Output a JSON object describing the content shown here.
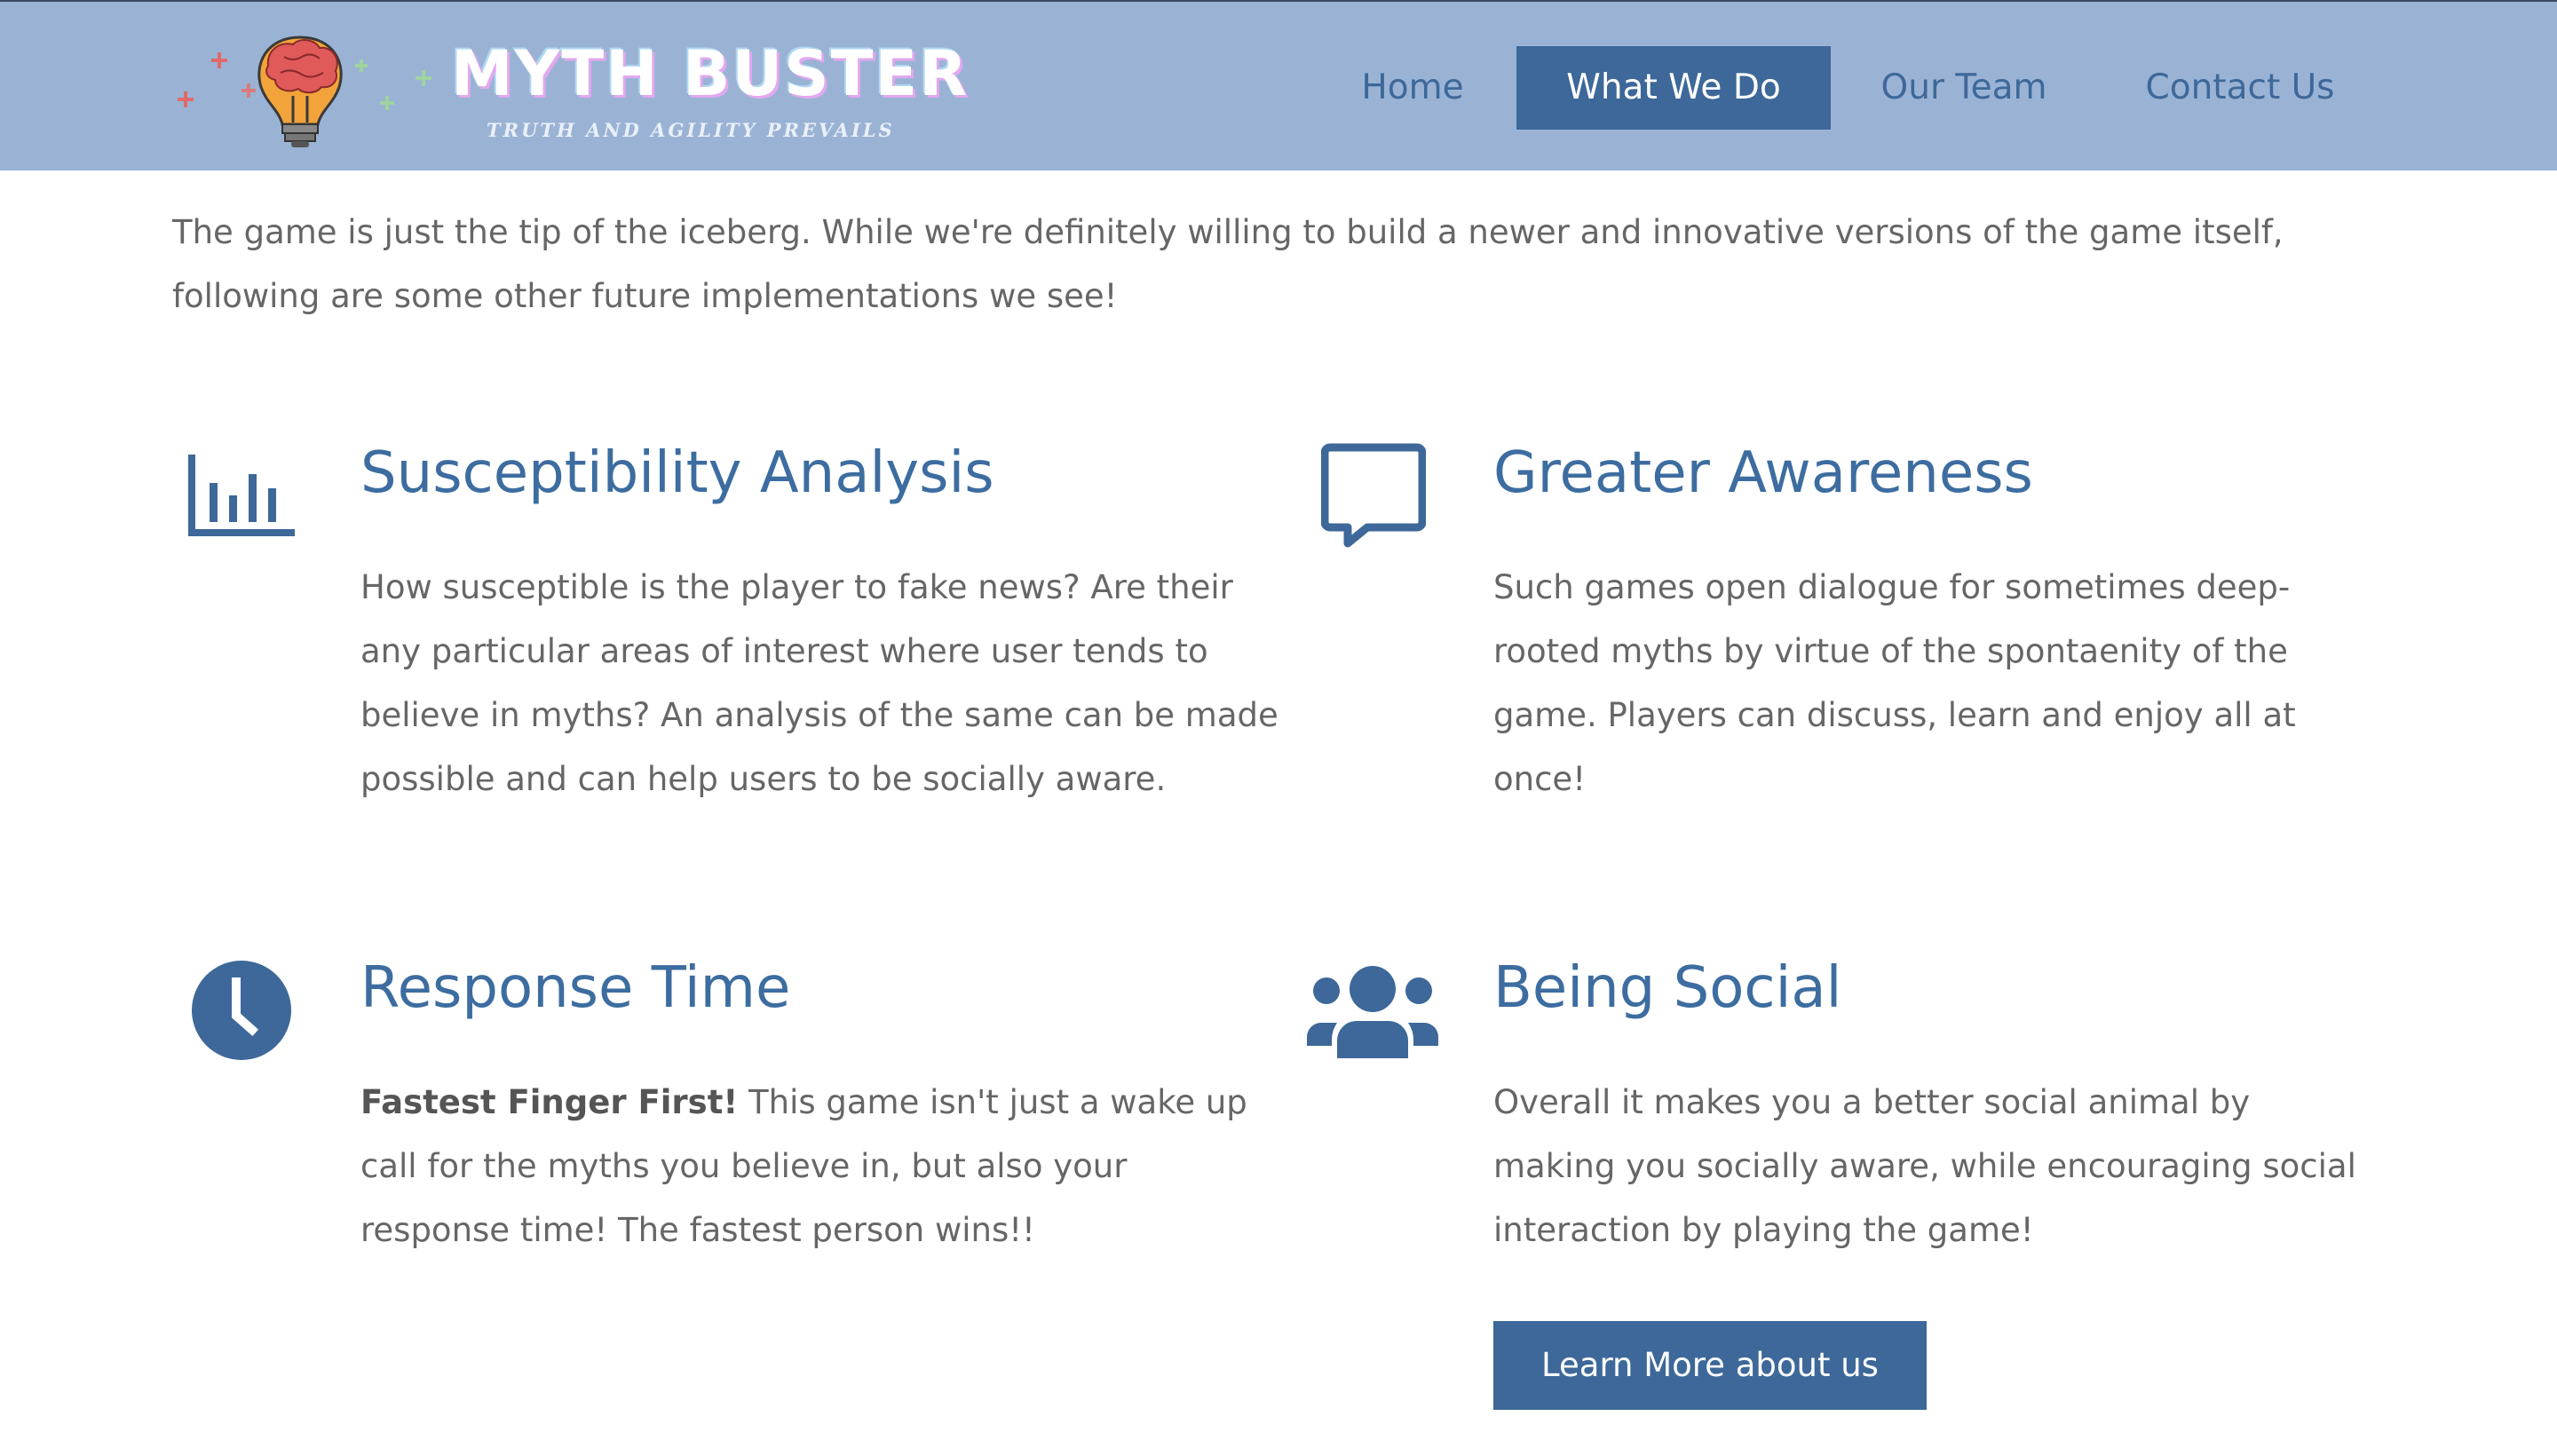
{
  "brand": {
    "title": "MYTH BUSTER",
    "tagline": "TRUTH AND AGILITY PREVAILS",
    "logo_icon": "lightbulb-brain-icon"
  },
  "nav": {
    "items": [
      {
        "label": "Home",
        "active": false
      },
      {
        "label": "What We Do",
        "active": true
      },
      {
        "label": "Our Team",
        "active": false
      },
      {
        "label": "Contact Us",
        "active": false
      }
    ]
  },
  "intro": "The game is just the tip of the iceberg. While we're definitely willing to build a newer and innovative versions of the game itself, following are some other future implementations we see!",
  "features": [
    {
      "icon": "bar-chart-icon",
      "title": "Susceptibility Analysis",
      "text": "How susceptible is the player to fake news? Are their any particular areas of interest where user tends to believe in myths? An analysis of the same can be made possible and can help users to be socially aware."
    },
    {
      "icon": "speech-bubble-icon",
      "title": "Greater Awareness",
      "text": "Such games open dialogue for sometimes deep-rooted myths by virtue of the spontaenity of the game. Players can discuss, learn and enjoy all at once!"
    },
    {
      "icon": "clock-icon",
      "title": "Response Time",
      "bold": "Fastest Finger First!",
      "text": " This game isn't just a wake up call for the myths you believe in, but also your response time! The fastest person wins!!"
    },
    {
      "icon": "users-group-icon",
      "title": "Being Social",
      "text": "Overall it makes you a better social animal by making you socially aware, while encouraging social interaction by playing the game!"
    }
  ],
  "cta": {
    "label": "Learn More about us"
  },
  "colors": {
    "header_bg": "#9ab3d5",
    "accent": "#3d6899",
    "heading": "#3d6da0",
    "body_text": "#666666"
  }
}
